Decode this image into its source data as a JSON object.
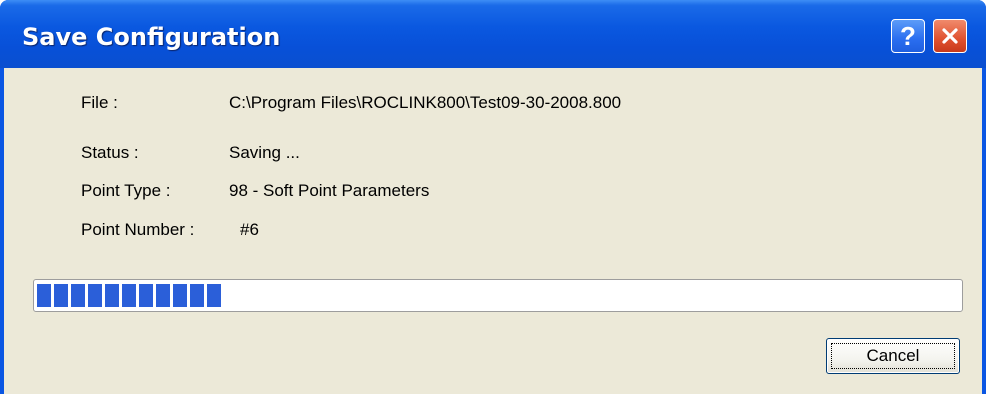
{
  "window": {
    "title": "Save Configuration"
  },
  "titlebar": {
    "help_icon": "help-question-icon",
    "close_icon": "close-x-icon"
  },
  "details": {
    "file_label": "File :",
    "file_value": "C:\\Program Files\\ROCLINK800\\Test09-30-2008.800",
    "status_label": "Status :",
    "status_value": "Saving ...",
    "point_type_label": "Point Type :",
    "point_type_value": "98 - Soft Point Parameters",
    "point_number_label": "Point Number :",
    "point_number_value": "#6"
  },
  "progress": {
    "percent": 21
  },
  "buttons": {
    "cancel_label": "Cancel"
  },
  "colors": {
    "titlebar": "#0a56e3",
    "client_bg": "#ece9d8",
    "progress_fill": "#2b5fd9",
    "close_button": "#e0512f"
  }
}
